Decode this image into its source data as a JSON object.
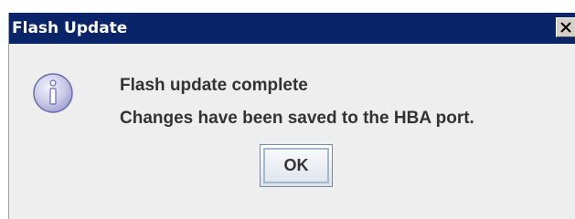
{
  "window": {
    "title": "Flash Update",
    "close_icon": "close-icon",
    "title_bar_color": "#0a246a"
  },
  "message": {
    "icon": "info-icon",
    "line1": "Flash update complete",
    "line2": "Changes have been saved to the HBA port."
  },
  "buttons": {
    "ok_label": "OK"
  }
}
